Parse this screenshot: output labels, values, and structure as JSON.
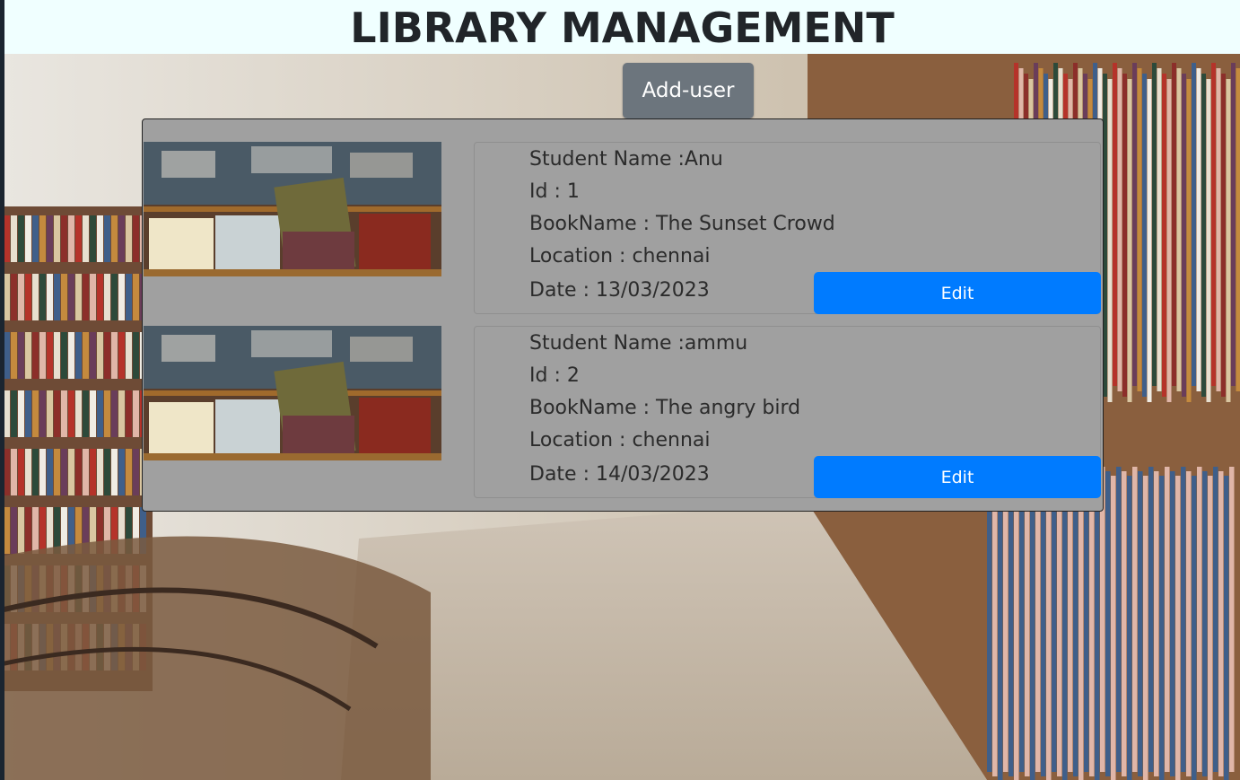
{
  "header": {
    "title": "LIBRARY MANAGEMENT"
  },
  "toolbar": {
    "add_user_label": "Add-user"
  },
  "records": [
    {
      "student_name": "Student Name :Anu",
      "id": "Id : 1",
      "book_name": "BookName : The Sunset Crowd",
      "location": "Location : chennai",
      "date": "Date : 13/03/2023",
      "edit_label": "Edit"
    },
    {
      "student_name": "Student Name :ammu",
      "id": "Id : 2",
      "book_name": "BookName : The angry bird",
      "location": "Location : chennai",
      "date": "Date : 14/03/2023",
      "edit_label": "Edit"
    }
  ],
  "colors": {
    "header_bg": "#f0ffff",
    "panel_bg": "#a0a0a0",
    "primary_button": "#007bff",
    "secondary_button": "#6c757d"
  }
}
